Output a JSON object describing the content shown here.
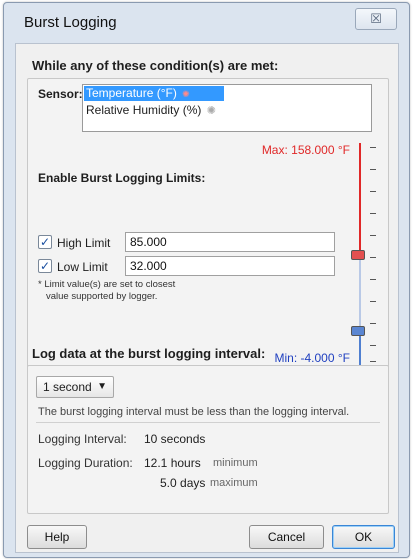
{
  "window": {
    "title": "Burst Logging",
    "close_glyph": "☒"
  },
  "conditions": {
    "heading": "While any of these condition(s) are met:",
    "sensor_label": "Sensor:",
    "sensors": [
      {
        "label": "Temperature (°F)",
        "selected": true,
        "icon": "thermometer-icon"
      },
      {
        "label": "Relative Humidity (%)",
        "selected": false,
        "icon": "humidity-icon"
      }
    ],
    "max_text": "Max: 158.000 °F",
    "min_text": "Min: -4.000 °F",
    "limits_heading": "Enable Burst Logging Limits:",
    "high": {
      "label": "High Limit",
      "value": "85.000",
      "checked": true
    },
    "low": {
      "label": "Low Limit",
      "value": "32.000",
      "checked": true
    },
    "note_line1": "* Limit value(s) are set to closest",
    "note_line2": "value supported by logger.",
    "colors": {
      "high_zone": "#e02828",
      "low_zone": "#4f7fd0",
      "mid_zone": "#b9c9e6"
    }
  },
  "interval": {
    "heading": "Log data at the burst logging interval:",
    "selected": "1 second",
    "hint": "The burst logging interval must be less than the logging interval.",
    "logging_interval_label": "Logging Interval:",
    "logging_interval_value": "10 seconds",
    "logging_duration_label": "Logging Duration:",
    "duration_min_value": "12.1 hours",
    "duration_min_note": "minimum",
    "duration_max_value": "5.0 days",
    "duration_max_note": "maximum"
  },
  "buttons": {
    "help": "Help",
    "cancel": "Cancel",
    "ok": "OK"
  }
}
